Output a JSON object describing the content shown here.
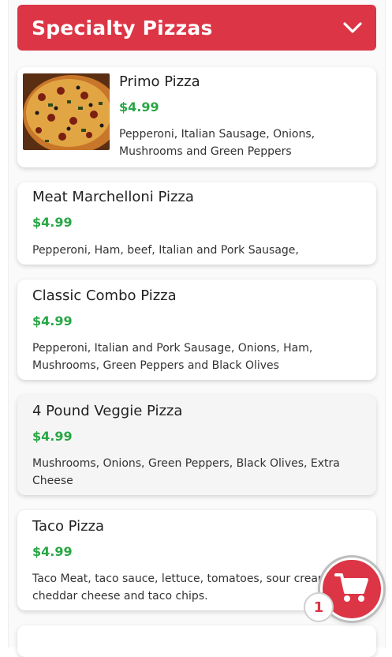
{
  "category": {
    "title": "Specialty Pizzas",
    "toggle_icon": "chevron-down-icon"
  },
  "items": [
    {
      "name": "Primo Pizza",
      "price": "$4.99",
      "description": "Pepperoni, Italian Sausage, Onions, Mushrooms and Green Peppers",
      "has_image": true
    },
    {
      "name": "Meat Marchelloni Pizza",
      "price": "$4.99",
      "description": "Pepperoni, Ham, beef, Italian and Pork Sausage,"
    },
    {
      "name": "Classic Combo Pizza",
      "price": "$4.99",
      "description": "Pepperoni, Italian and Pork Sausage, Onions, Ham, Mushrooms, Green Peppers and Black Olives"
    },
    {
      "name": "4 Pound Veggie Pizza",
      "price": "$4.99",
      "description": "Mushrooms, Onions, Green Peppers, Black Olives, Extra Cheese"
    },
    {
      "name": "Taco Pizza",
      "price": "$4.99",
      "description": "Taco Meat, taco sauce, lettuce, tomatoes, sour cream, cheddar cheese and taco chips."
    }
  ],
  "cart": {
    "count": "1",
    "icon": "cart-icon"
  },
  "colors": {
    "accent": "#dc3545",
    "price": "#28a745"
  }
}
